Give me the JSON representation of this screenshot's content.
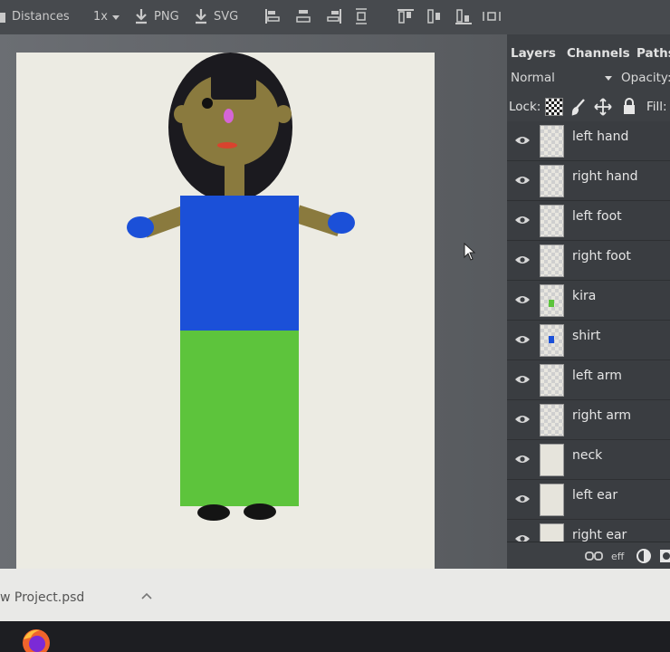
{
  "toolbar": {
    "distances_label": "Distances",
    "zoom_label": "1x",
    "png_label": "PNG",
    "svg_label": "SVG"
  },
  "panel": {
    "tabs": [
      "Layers",
      "Channels",
      "Paths"
    ],
    "blend_mode": "Normal",
    "opacity_label": "Opacity:",
    "lock_label": "Lock:",
    "fill_label": "Fill:",
    "layers": [
      {
        "name": "left hand"
      },
      {
        "name": "right hand"
      },
      {
        "name": "left foot"
      },
      {
        "name": "right foot"
      },
      {
        "name": "kira"
      },
      {
        "name": "shirt"
      },
      {
        "name": "left arm"
      },
      {
        "name": "right arm"
      },
      {
        "name": "neck"
      },
      {
        "name": "left ear"
      },
      {
        "name": "right ear"
      }
    ],
    "footer_icons": [
      "link-icon",
      "effects-icon",
      "adjustment-icon",
      "mask-icon"
    ]
  },
  "downloads": {
    "filename": "w Project.psd"
  },
  "colors": {
    "skin": "#8a7a3e",
    "hair": "#1b1a1f",
    "shirt": "#1b50d8",
    "kira": "#5dc43c",
    "hands": "#1b50d8",
    "feet": "#141414",
    "bindi": "#d565d6",
    "lips": "#d9432e",
    "canvas": "#ecebe3"
  }
}
